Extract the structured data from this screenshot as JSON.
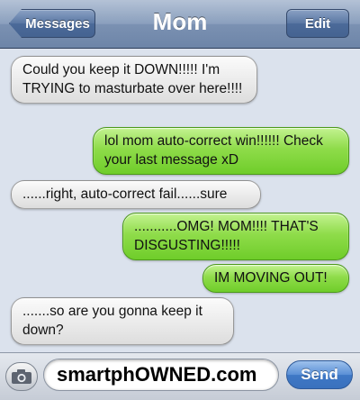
{
  "header": {
    "back_label": "Messages",
    "title": "Mom",
    "edit_label": "Edit"
  },
  "messages": [
    {
      "sender": "received",
      "text": "Could you keep it DOWN!!!!! I'm TRYING to masturbate over here!!!!"
    },
    {
      "sender": "sent",
      "text": "lol mom auto-correct win!!!!!! Check your last message xD"
    },
    {
      "sender": "received",
      "text": "......right, auto-correct fail......sure"
    },
    {
      "sender": "sent",
      "text": "...........OMG! MOM!!!! THAT'S DISGUSTING!!!!!"
    },
    {
      "sender": "sent",
      "text": "IM MOVING OUT!"
    },
    {
      "sender": "received",
      "text": ".......so are you gonna keep it down?"
    }
  ],
  "composer": {
    "camera_icon": "camera-icon",
    "input_value": "smartphOWNED.com",
    "send_label": "Send"
  },
  "colors": {
    "background": "#dbe2ed",
    "sent_bubble": "#8fdc4a",
    "received_bubble": "#ececec",
    "navbar": "#7b91b2",
    "send_button": "#3f78c6"
  }
}
